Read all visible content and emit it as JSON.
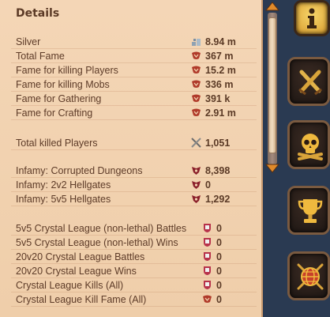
{
  "panel": {
    "title": "Details"
  },
  "groups": [
    {
      "rows": [
        {
          "label": "Silver",
          "icon": "silver-icon",
          "value": "8.94 m"
        },
        {
          "label": "Total Fame",
          "icon": "fame-icon",
          "value": "367 m"
        },
        {
          "label": "Fame for killing Players",
          "icon": "fame-icon",
          "value": "15.2 m"
        },
        {
          "label": "Fame for killing Mobs",
          "icon": "fame-icon",
          "value": "336 m"
        },
        {
          "label": "Fame for Gathering",
          "icon": "fame-icon",
          "value": "391 k"
        },
        {
          "label": "Fame for Crafting",
          "icon": "fame-icon",
          "value": "2.91 m"
        }
      ]
    },
    {
      "rows": [
        {
          "label": "Total killed Players",
          "icon": "crossed-swords-icon",
          "value": "1,051"
        }
      ]
    },
    {
      "rows": [
        {
          "label": "Infamy: Corrupted Dungeons",
          "icon": "infamy-icon",
          "value": "8,398"
        },
        {
          "label": "Infamy: 2v2 Hellgates",
          "icon": "infamy-icon",
          "value": "0"
        },
        {
          "label": "Infamy: 5v5 Hellgates",
          "icon": "infamy-icon",
          "value": "1,292"
        }
      ]
    },
    {
      "rows": [
        {
          "label": "5v5 Crystal League (non-lethal) Battles",
          "icon": "crystal-icon",
          "value": "0"
        },
        {
          "label": "5v5 Crystal League (non-lethal) Wins",
          "icon": "crystal-icon",
          "value": "0"
        },
        {
          "label": "20v20 Crystal League Battles",
          "icon": "crystal-icon",
          "value": "0"
        },
        {
          "label": "20v20 Crystal League Wins",
          "icon": "crystal-icon",
          "value": "0"
        },
        {
          "label": "Crystal League Kills (All)",
          "icon": "crystal-icon",
          "value": "0"
        },
        {
          "label": "Crystal League Kill Fame (All)",
          "icon": "fame-icon",
          "value": "0"
        }
      ]
    }
  ],
  "tabs": [
    {
      "name": "details",
      "icon": "info-icon",
      "active": true
    },
    {
      "name": "combat",
      "icon": "crossed-swords-icon"
    },
    {
      "name": "pvp",
      "icon": "skull-icon"
    },
    {
      "name": "achievements",
      "icon": "trophy-icon"
    },
    {
      "name": "guild",
      "icon": "guild-globe-icon"
    }
  ],
  "colors": {
    "panel_bg": "#f2d2b0",
    "text": "#5d3b28",
    "tab_gold": "#e5b446",
    "background": "#2a3a52"
  }
}
